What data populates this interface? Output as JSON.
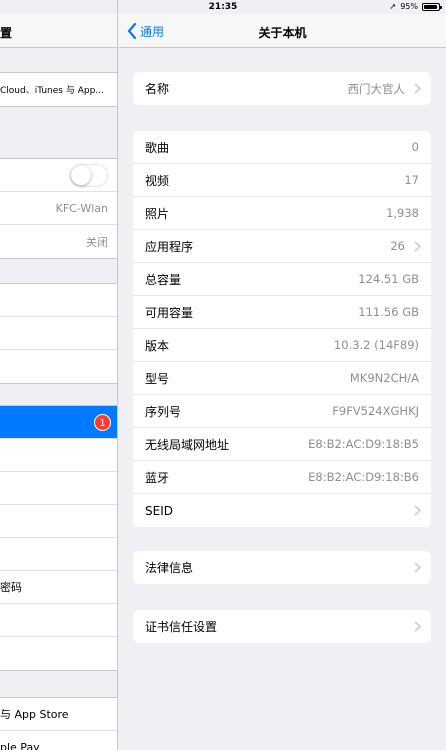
{
  "status_bar": {
    "time": "21:35",
    "battery": "95%",
    "battery_level": 0.95
  },
  "master": {
    "title": "置",
    "rows": [
      {
        "text": "Cloud、iTunes 与 App...",
        "value": ""
      },
      {
        "text": "",
        "value": "",
        "toggle": "off"
      },
      {
        "text": "",
        "value": "KFC-Wlan"
      },
      {
        "text": "",
        "value": "关闭"
      },
      {
        "text": "",
        "value": ""
      },
      {
        "text": "",
        "value": ""
      },
      {
        "text": "",
        "value": ""
      },
      {
        "text": "",
        "value": "",
        "badge": "1"
      },
      {
        "text": "",
        "value": ""
      },
      {
        "text": "",
        "value": ""
      },
      {
        "text": "",
        "value": ""
      },
      {
        "text": "",
        "value": ""
      },
      {
        "text": "密码",
        "value": ""
      },
      {
        "text": "",
        "value": ""
      },
      {
        "text": "",
        "value": ""
      },
      {
        "text": "与 App Store",
        "value": ""
      },
      {
        "text": "ple Pay",
        "value": ""
      }
    ]
  },
  "detail": {
    "back_label": "通用",
    "title": "关于本机",
    "name_row": {
      "label": "名称",
      "value": "西门大官人"
    },
    "info_rows": [
      {
        "label": "歌曲",
        "value": "0",
        "chevron": false
      },
      {
        "label": "视频",
        "value": "17",
        "chevron": false
      },
      {
        "label": "照片",
        "value": "1,938",
        "chevron": false
      },
      {
        "label": "应用程序",
        "value": "26",
        "chevron": true
      },
      {
        "label": "总容量",
        "value": "124.51 GB",
        "chevron": false
      },
      {
        "label": "可用容量",
        "value": "111.56 GB",
        "chevron": false
      },
      {
        "label": "版本",
        "value": "10.3.2 (14F89)",
        "chevron": false
      },
      {
        "label": "型号",
        "value": "MK9N2CH/A",
        "chevron": false
      },
      {
        "label": "序列号",
        "value": "F9FV524XGHKJ",
        "chevron": false
      },
      {
        "label": "无线局域网地址",
        "value": "E8:B2:AC:D9:18:B5",
        "chevron": false
      },
      {
        "label": "蓝牙",
        "value": "E8:B2:AC:D9:18:B6",
        "chevron": false
      },
      {
        "label": "SEID",
        "value": "",
        "chevron": true
      }
    ],
    "legal_row": {
      "label": "法律信息"
    },
    "cert_row": {
      "label": "证书信任设置"
    }
  },
  "colors": {
    "accent": "#007aff",
    "background": "#efeff4",
    "secondary_text": "#8e8e93",
    "badge": "#ff3b30"
  }
}
